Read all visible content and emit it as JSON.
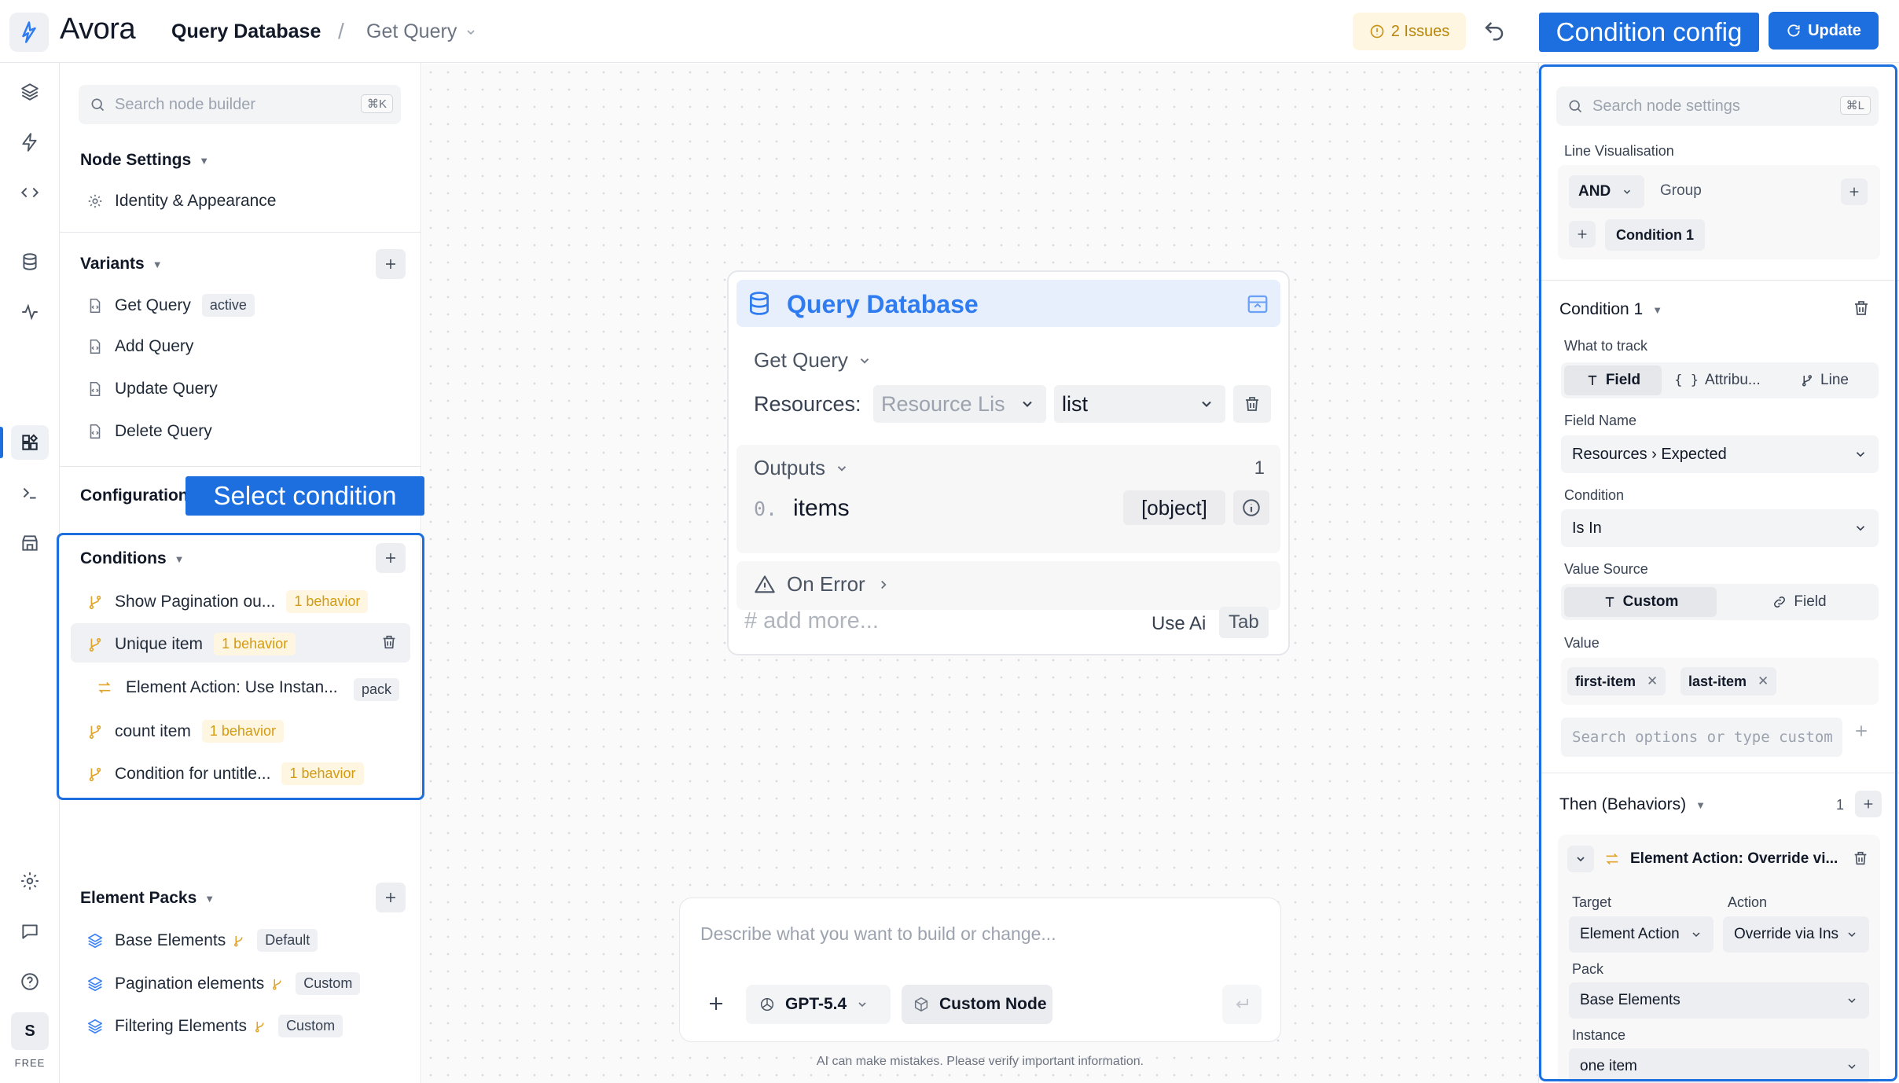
{
  "app": {
    "brand": "Avora",
    "free_label": "FREE",
    "avatar_initial": "S"
  },
  "header": {
    "breadcrumb_1": "Query Database",
    "breadcrumb_2": "Get Query",
    "issues_label": "2 Issues",
    "update_label": "Update"
  },
  "callouts": {
    "condition_config": "Condition config",
    "select_condition": "Select condition"
  },
  "left": {
    "search_placeholder": "Search node builder",
    "search_shortcut": "⌘K",
    "node_settings": {
      "title": "Node Settings",
      "items": [
        "Identity & Appearance"
      ]
    },
    "variants": {
      "title": "Variants",
      "items": [
        {
          "label": "Get Query",
          "tag": "active"
        },
        {
          "label": "Add Query"
        },
        {
          "label": "Update Query"
        },
        {
          "label": "Delete Query"
        }
      ]
    },
    "configuration_title": "Configuration",
    "conditions": {
      "title": "Conditions",
      "items": [
        {
          "label": "Show Pagination ou...",
          "tag": "1 behavior"
        },
        {
          "label": "Unique item",
          "tag": "1 behavior"
        },
        {
          "label": "Element Action: Use Instan...",
          "tag": "pack"
        },
        {
          "label": "count item",
          "tag": "1 behavior"
        },
        {
          "label": "Condition for untitle...",
          "tag": "1 behavior"
        }
      ]
    },
    "element_packs": {
      "title": "Element Packs",
      "items": [
        {
          "label": "Base Elements",
          "tag": "Default"
        },
        {
          "label": "Pagination elements",
          "tag": "Custom"
        },
        {
          "label": "Filtering Elements",
          "tag": "Custom"
        }
      ]
    }
  },
  "node": {
    "title": "Query Database",
    "variant": "Get Query",
    "resources_label": "Resources:",
    "resource_placeholder": "Resource Lis",
    "resource_type": "list",
    "outputs_label": "Outputs",
    "outputs_count": "1",
    "output_index": "0.",
    "output_name": "items",
    "output_type": "[object]",
    "on_error_label": "On Error",
    "add_more": "# add more...",
    "use_ai": "Use Ai",
    "tab_key": "Tab"
  },
  "chat": {
    "placeholder": "Describe what you want to build or change...",
    "model": "GPT-5.4",
    "mode": "Custom Node",
    "disclaimer": "AI can make mistakes. Please verify important information."
  },
  "right": {
    "search_placeholder": "Search node settings",
    "search_shortcut": "⌘L",
    "line_vis_label": "Line Visualisation",
    "and_label": "AND",
    "group_label": "Group",
    "condition_chip": "Condition 1",
    "condition_title": "Condition 1",
    "what_to_track_label": "What to track",
    "track_options": [
      "Field",
      "Attribu...",
      "Line"
    ],
    "field_name_label": "Field Name",
    "field_name_value": "Resources › Expected",
    "condition_label": "Condition",
    "condition_value": "Is In",
    "value_source_label": "Value Source",
    "value_source_options": [
      "Custom",
      "Field"
    ],
    "value_label": "Value",
    "value_chips": [
      "first-item",
      "last-item"
    ],
    "value_search_placeholder": "Search options or type custom",
    "then_label": "Then (Behaviors)",
    "then_count": "1",
    "behavior_title": "Element Action: Override vi...",
    "target_label": "Target",
    "target_value": "Element Action",
    "action_label": "Action",
    "action_value": "Override via Ins",
    "pack_label": "Pack",
    "pack_value": "Base Elements",
    "instance_label": "Instance",
    "instance_value": "one item"
  },
  "colors": {
    "accent": "#1d6fe0",
    "node_title": "#2f7cf0",
    "warning": "#d49b10"
  }
}
